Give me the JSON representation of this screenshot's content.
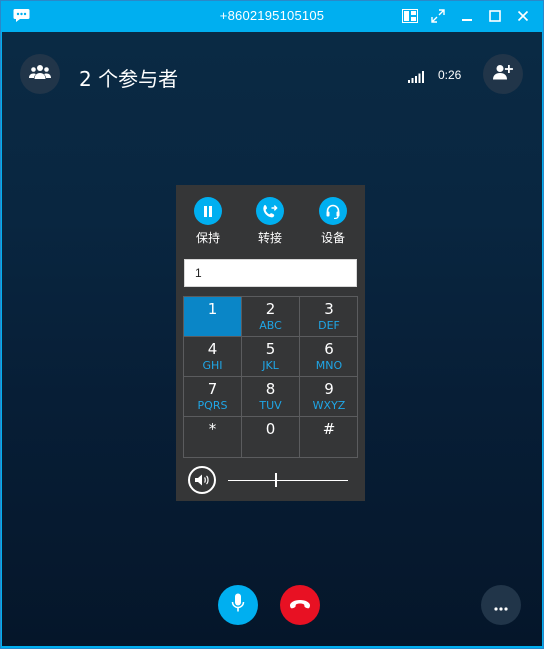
{
  "window": {
    "title": "+8602195105105",
    "icons": [
      "skype-chat-icon",
      "layout-icon",
      "fullscreen-icon",
      "minimize-icon",
      "maximize-icon",
      "close-icon"
    ]
  },
  "header": {
    "participants_label": "2 个参与者",
    "call_duration": "0:26",
    "icons": [
      "people-icon",
      "signal-icon",
      "add-person-icon"
    ]
  },
  "dialpad": {
    "actions": [
      {
        "label": "保持",
        "icon": "pause-icon"
      },
      {
        "label": "转接",
        "icon": "transfer-icon"
      },
      {
        "label": "设备",
        "icon": "headset-icon"
      }
    ],
    "input_value": "1",
    "keys": [
      {
        "num": "1",
        "letters": ""
      },
      {
        "num": "2",
        "letters": "ABC"
      },
      {
        "num": "3",
        "letters": "DEF"
      },
      {
        "num": "4",
        "letters": "GHI"
      },
      {
        "num": "5",
        "letters": "JKL"
      },
      {
        "num": "6",
        "letters": "MNO"
      },
      {
        "num": "7",
        "letters": "PQRS"
      },
      {
        "num": "8",
        "letters": "TUV"
      },
      {
        "num": "9",
        "letters": "WXYZ"
      },
      {
        "num": "*",
        "letters": ""
      },
      {
        "num": "0",
        "letters": ""
      },
      {
        "num": "#",
        "letters": ""
      }
    ],
    "active_key": "1",
    "volume_level": 0.4
  },
  "controls": {
    "icons": [
      "microphone-icon",
      "hang-up-icon",
      "more-icon"
    ]
  },
  "colors": {
    "accent": "#00aff0",
    "hangup": "#e81123",
    "dialpad_bg": "#353637",
    "stage_top": "#0a2a44",
    "stage_bottom": "#05162a"
  }
}
